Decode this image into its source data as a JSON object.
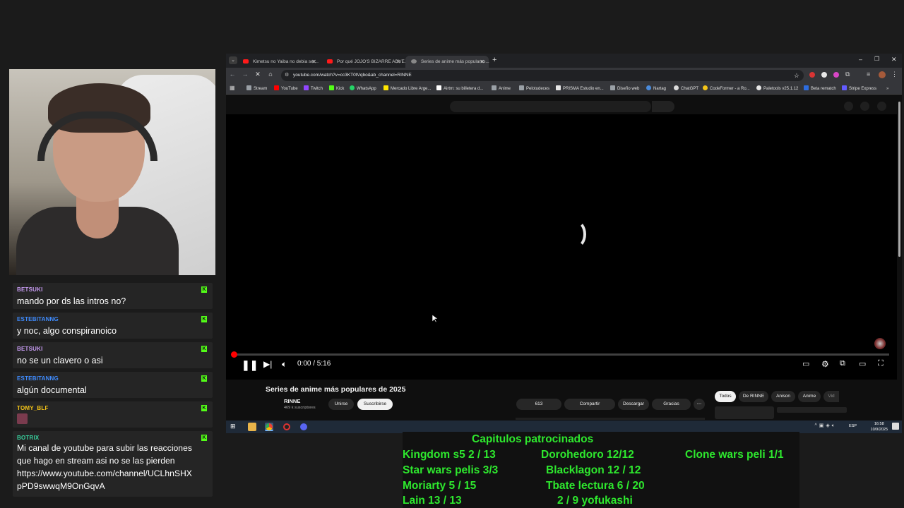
{
  "chat": [
    {
      "user": "BETSUKI",
      "user_color": "#c79bf2",
      "text": "mando por ds las intros no?"
    },
    {
      "user": "ESTEBITANNG",
      "user_color": "#3f8cff",
      "text": "y noc, algo conspiranoico"
    },
    {
      "user": "BETSUKI",
      "user_color": "#c79bf2",
      "text": "no se un clavero o asi"
    },
    {
      "user": "ESTEBITANNG",
      "user_color": "#3f8cff",
      "text": "algún documental"
    },
    {
      "user": "TOMY_BLF",
      "user_color": "#f5c518",
      "text": ""
    },
    {
      "user": "BOTRIX",
      "user_color": "#38d39f",
      "text_lines": [
        "Mi canal de youtube para subir las reacciones",
        "que hago en stream asi no se las pierden",
        "https://www.youtube.com/channel/UCLhnSHX",
        "pPD9swwqM9OnGqvA"
      ]
    }
  ],
  "browser": {
    "tabs": [
      {
        "label": "Kimetsu no Yaiba no debia ser..."
      },
      {
        "label": "Por qué JOJO'S BIZARRE ADVE..."
      },
      {
        "label": "Series de anime más populares..."
      }
    ],
    "url": "youtube.com/watch?v=cc3KT0tVqbo&ab_channel=RINNE",
    "bookmarks": [
      "Stream",
      "YouTube",
      "Twitch",
      "Kick",
      "WhatsApp",
      "Mercado Libre Arge...",
      "Airtm: su billetera d...",
      "Anime",
      "Pelotudeces",
      "PRISMA Estudio en...",
      "Diseño web",
      "Nartag",
      "ChatGPT",
      "CodeFormer - a Ro...",
      "Paletools v25.1.12",
      "Beta rematch",
      "Stripe Express"
    ]
  },
  "player": {
    "time": "0:00 / 5:16",
    "progress": 0
  },
  "video": {
    "title": "Series de anime más populares de 2025",
    "channel": "RINNE",
    "subscribers": "469 k suscriptores",
    "join_label": "Unirse",
    "subscribe_label": "Suscribirse",
    "likes": "613",
    "share_label": "Compartir",
    "download_label": "Descargar",
    "thanks_label": "Gracias",
    "chips": [
      "Todos",
      "De RINNE",
      "Anison",
      "Anime",
      "Vid"
    ]
  },
  "taskbar": {
    "lang": "ESP",
    "time": "16:58",
    "date": "10/9/2025"
  },
  "sponsor": {
    "title": "Capitulos patrocinados",
    "items": [
      "Kingdom s5 2 / 13",
      "Dorohedoro 12/12",
      "Clone wars peli 1/1",
      "Star wars pelis 3/3",
      "Blacklagon 12 / 12",
      "Moriarty 5 / 15",
      "Tbate lectura 6 / 20",
      "Lain 13 / 13",
      "2 / 9 yofukashi"
    ]
  }
}
